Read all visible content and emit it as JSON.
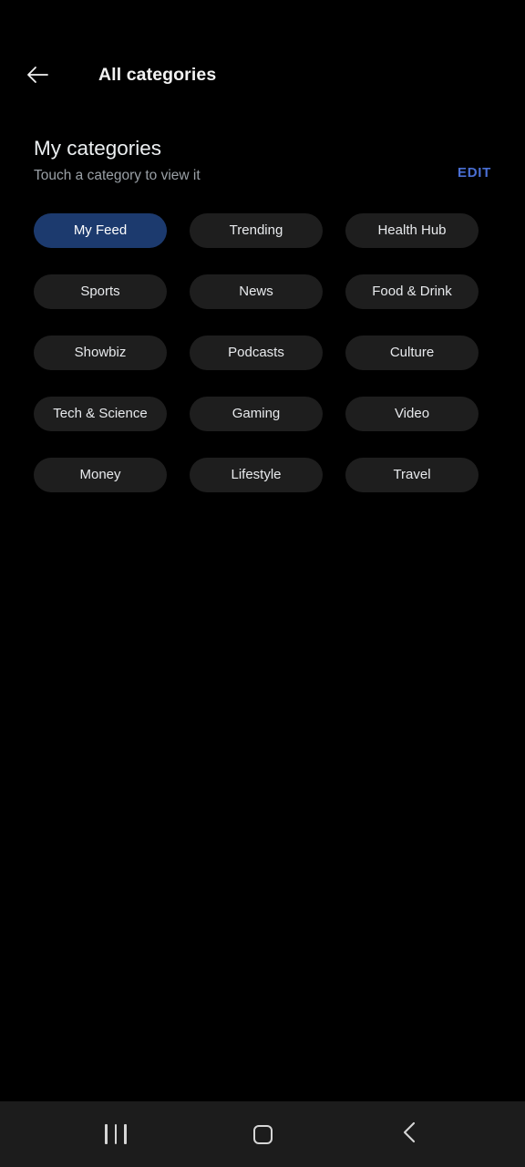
{
  "appbar": {
    "back_icon": "arrow-left-icon",
    "title": "All categories"
  },
  "section": {
    "title": "My categories",
    "subtitle": "Touch a category to view it",
    "edit_label": "EDIT",
    "edit_color": "#4a6fd4"
  },
  "categories": [
    {
      "label": "My Feed",
      "selected": true
    },
    {
      "label": "Trending",
      "selected": false
    },
    {
      "label": "Health Hub",
      "selected": false
    },
    {
      "label": "Sports",
      "selected": false
    },
    {
      "label": "News",
      "selected": false
    },
    {
      "label": "Food & Drink",
      "selected": false
    },
    {
      "label": "Showbiz",
      "selected": false
    },
    {
      "label": "Podcasts",
      "selected": false
    },
    {
      "label": "Culture",
      "selected": false
    },
    {
      "label": "Tech & Science",
      "selected": false
    },
    {
      "label": "Gaming",
      "selected": false
    },
    {
      "label": "Video",
      "selected": false
    },
    {
      "label": "Money",
      "selected": false
    },
    {
      "label": "Lifestyle",
      "selected": false
    },
    {
      "label": "Travel",
      "selected": false
    }
  ],
  "chip_colors": {
    "selected_bg": "#1c3a6e",
    "unselected_bg": "#1e1e1e",
    "text": "#e8eaed"
  },
  "navbar": {
    "background": "#1c1c1c",
    "buttons": [
      {
        "icon": "recents-icon"
      },
      {
        "icon": "home-icon"
      },
      {
        "icon": "back-chevron-icon"
      }
    ]
  }
}
